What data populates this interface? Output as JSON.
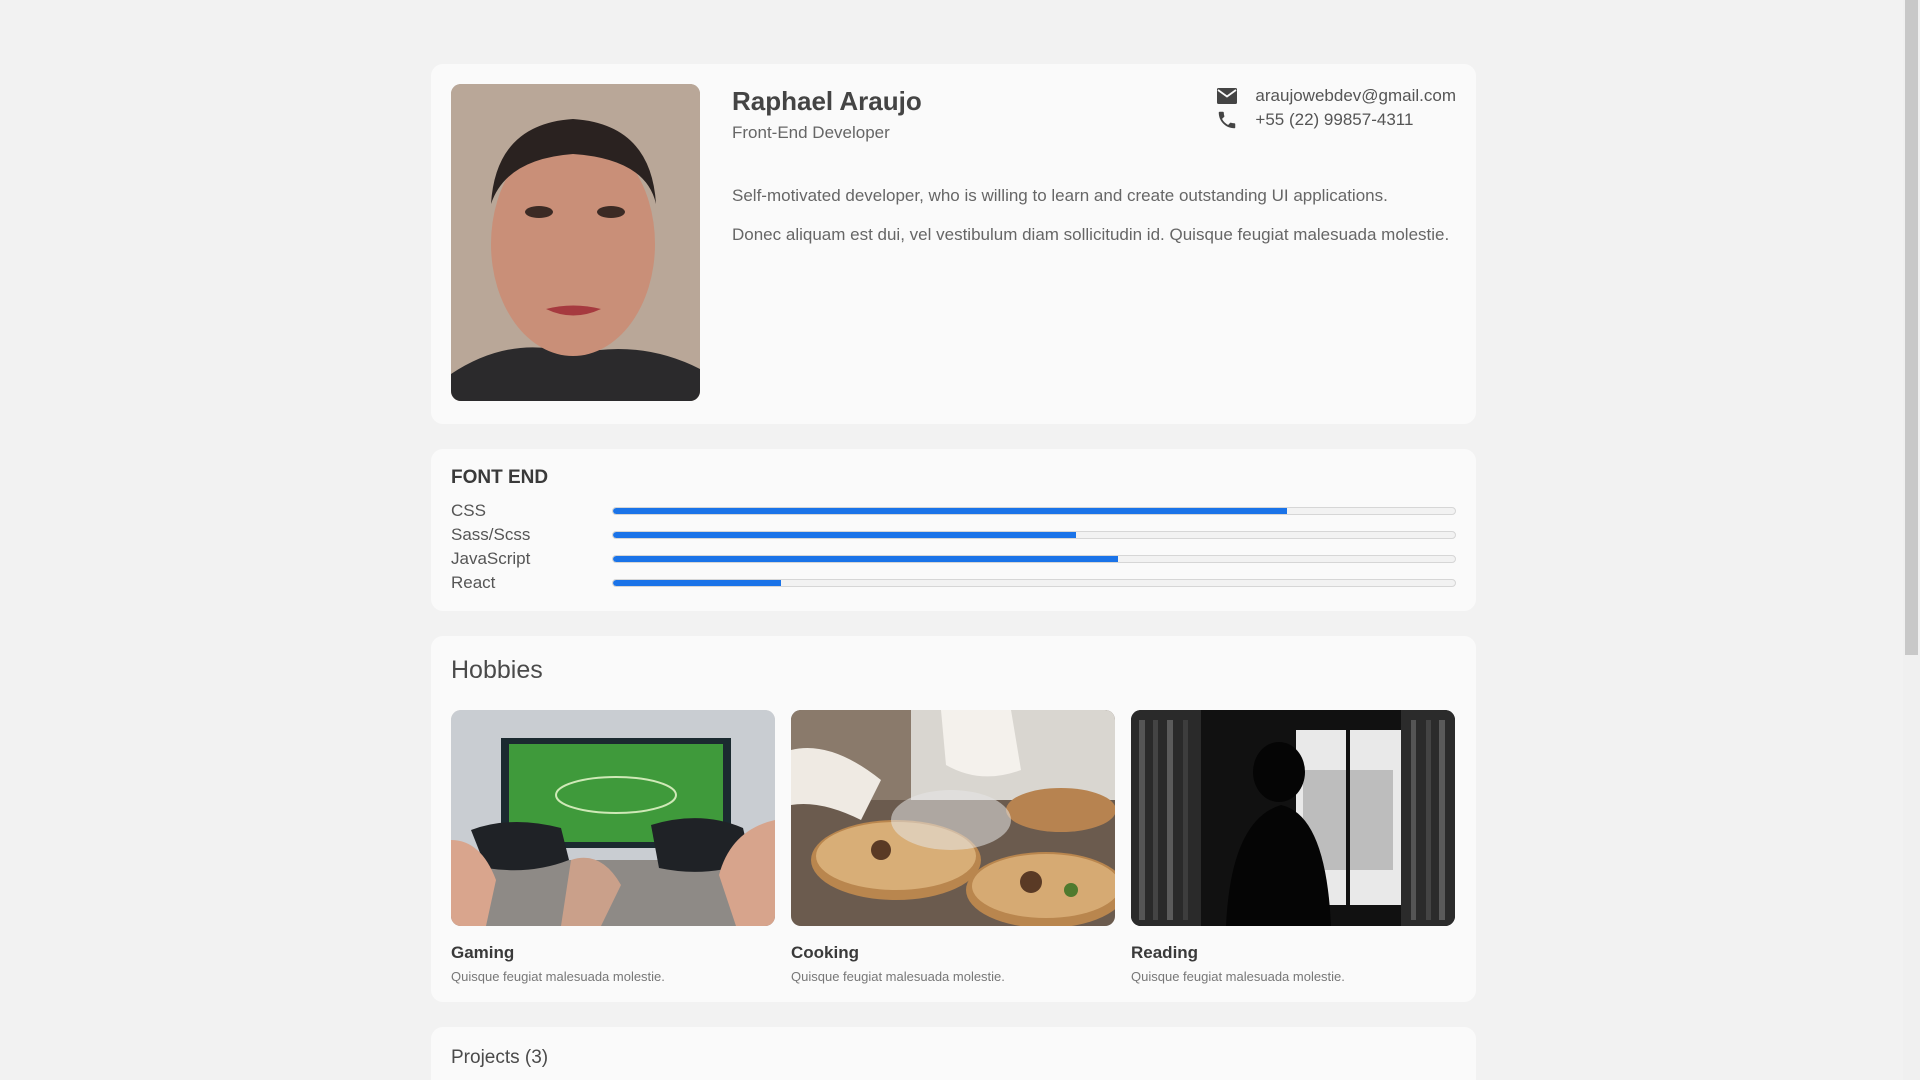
{
  "profile": {
    "name": "Raphael Araujo",
    "role": "Front-End Developer",
    "email": "araujowebdev@gmail.com",
    "phone": "+55 (22) 99857-4311",
    "bio": [
      "Self-motivated developer, who is willing to learn and create outstanding UI applications.",
      "Donec aliquam est dui, vel vestibulum diam sollicitudin id. Quisque feugiat malesuada molestie."
    ]
  },
  "skills": {
    "title": "FONT END",
    "items": [
      {
        "label": "CSS",
        "level": 0.8
      },
      {
        "label": "Sass/Scss",
        "level": 0.55
      },
      {
        "label": "JavaScript",
        "level": 0.6
      },
      {
        "label": "React",
        "level": 0.2
      }
    ],
    "accent": "#1a73e8"
  },
  "hobbies": {
    "title": "Hobbies",
    "items": [
      {
        "title": "Gaming",
        "desc": "Quisque feugiat malesuada molestie."
      },
      {
        "title": "Cooking",
        "desc": "Quisque feugiat malesuada molestie."
      },
      {
        "title": "Reading",
        "desc": "Quisque feugiat malesuada molestie."
      }
    ]
  },
  "projects": {
    "title": "Projects (3)"
  }
}
